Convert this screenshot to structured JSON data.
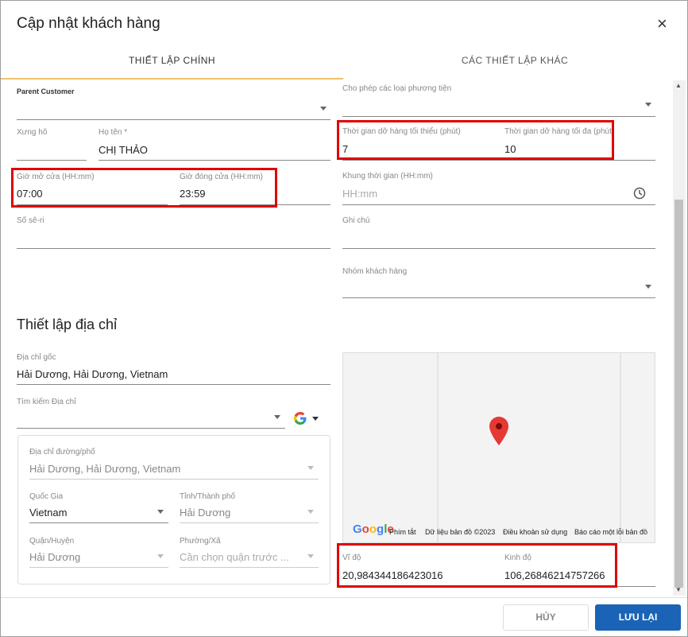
{
  "dialog": {
    "title": "Cập nhật khách hàng",
    "close": "×"
  },
  "tabs": [
    {
      "label": "THIẾT LẬP CHÍNH"
    },
    {
      "label": "CÁC THIẾT LẬP KHÁC"
    }
  ],
  "left": {
    "parent_customer": {
      "label": "Parent Customer",
      "value": ""
    },
    "salutation": {
      "label": "Xưng hô",
      "value": ""
    },
    "fullname": {
      "label": "Họ tên *",
      "value": "CHỊ THẢO"
    },
    "open_time": {
      "label": "Giờ mở cửa (HH:mm)",
      "value": "07:00"
    },
    "close_time": {
      "label": "Giờ đóng cửa (HH:mm)",
      "value": "23:59"
    },
    "serial": {
      "label": "Số sê-ri",
      "value": ""
    }
  },
  "right": {
    "vehicles": {
      "label": "Cho phép các loại phương tiện",
      "value": ""
    },
    "min_unload": {
      "label": "Thời gian dỡ hàng tối thiểu (phút)",
      "value": "7"
    },
    "max_unload": {
      "label": "Thời gian dỡ hàng tối đa (phút)",
      "value": "10"
    },
    "time_window": {
      "label": "Khung thời gian (HH:mm)",
      "placeholder": "HH:mm"
    },
    "note": {
      "label": "Ghi chú",
      "value": ""
    },
    "group": {
      "label": "Nhóm khách hàng",
      "value": ""
    }
  },
  "address": {
    "section_title": "Thiết lập địa chỉ",
    "origin": {
      "label": "Địa chỉ gốc",
      "value": "Hải Dương, Hải Dương, Vietnam"
    },
    "search": {
      "label": "Tìm kiếm Địa chỉ",
      "value": ""
    },
    "street": {
      "label": "Địa chỉ đường/phố",
      "value": "Hải Dương, Hải Dương, Vietnam"
    },
    "country": {
      "label": "Quốc Gia",
      "value": "Vietnam"
    },
    "province": {
      "label": "Tỉnh/Thành phố",
      "value": "Hải Dương"
    },
    "district": {
      "label": "Quận/Huyện",
      "value": "Hải Dương"
    },
    "ward": {
      "label": "Phường/Xã",
      "placeholder": "Cần chọn quận trước ..."
    }
  },
  "map": {
    "google": "Google",
    "footer": [
      "Phím tắt",
      "Dữ liệu bản đồ ©2023",
      "Điều khoản sử dụng",
      "Báo cáo một lỗi bản đồ"
    ]
  },
  "coords": {
    "lat": {
      "label": "Vĩ độ",
      "value": "20,984344186423016"
    },
    "lng": {
      "label": "Kinh độ",
      "value": "106,26846214757266"
    }
  },
  "buttons": {
    "cancel": "HỦY",
    "save": "LƯU LẠI"
  },
  "colors": {
    "primary": "#1a63b6",
    "highlight": "#e00000",
    "pin": "#e53935"
  }
}
